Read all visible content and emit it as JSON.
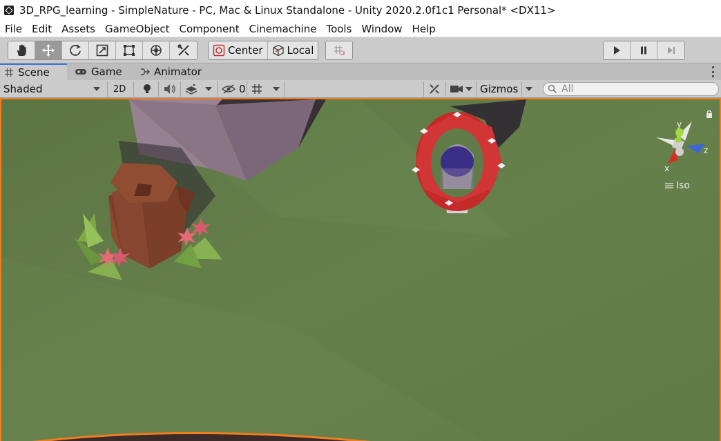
{
  "window": {
    "title": "3D_RPG_learning - SimpleNature - PC, Mac & Linux Standalone - Unity 2020.2.0f1c1 Personal* <DX11>"
  },
  "menu": {
    "items": [
      "File",
      "Edit",
      "Assets",
      "GameObject",
      "Component",
      "Cinemachine",
      "Tools",
      "Window",
      "Help"
    ]
  },
  "toolbar": {
    "tools": [
      "hand-tool",
      "move-tool",
      "rotate-tool",
      "scale-tool",
      "rect-tool",
      "transform-tool",
      "custom-tool"
    ],
    "active_tool": "move-tool",
    "pivot_label": "Center",
    "space_label": "Local",
    "snap_icon": "grid-snap-icon",
    "playback": [
      "play",
      "pause",
      "step"
    ]
  },
  "tabs": [
    {
      "label": "Scene",
      "icon": "grid-icon",
      "active": true
    },
    {
      "label": "Game",
      "icon": "gamepad-icon",
      "active": false
    },
    {
      "label": "Animator",
      "icon": "animator-icon",
      "active": false
    }
  ],
  "scene_toolbar": {
    "draw_mode": "Shaded",
    "mode_2d": "2D",
    "hidden_count": "0",
    "gizmos_label": "Gizmos",
    "search_placeholder": "All"
  },
  "scene_view": {
    "projection_label": "Iso",
    "gizmo_axes": {
      "x": "x",
      "y": "y",
      "z": "z"
    },
    "colors": {
      "ground": "#5f7a45",
      "selection_outline": "#f07d1f",
      "rock": "#8a7585",
      "stump": "#7b3e28",
      "ring": "#c42a2a",
      "orb": "#3a2f86"
    }
  }
}
